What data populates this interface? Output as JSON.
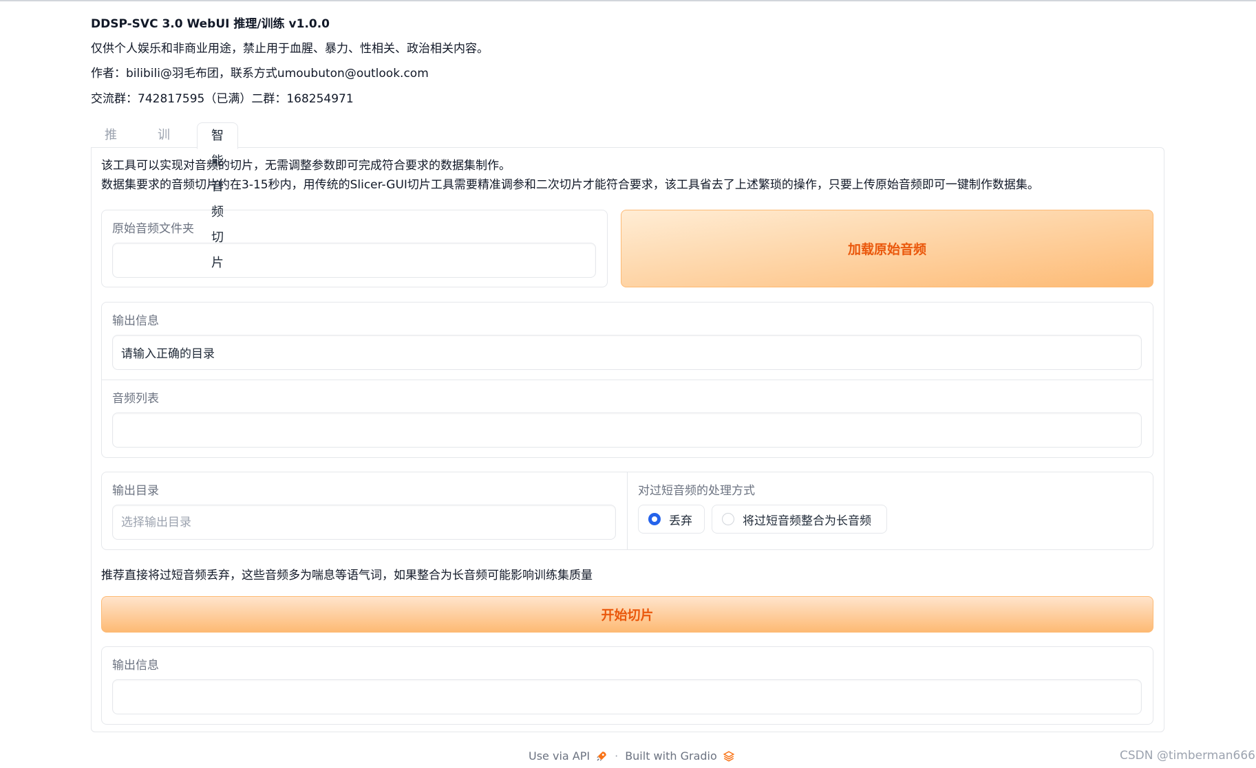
{
  "header": {
    "title": "DDSP-SVC 3.0 WebUI 推理/训练 v1.0.0",
    "notice": "仅供个人娱乐和非商业用途，禁止用于血腥、暴力、性相关、政治相关内容。",
    "author": "作者：bilibili@羽毛布团，联系方式umoubuton@outlook.com",
    "group": "交流群：742817595（已满）二群：168254971"
  },
  "tabs": {
    "infer": "推理",
    "train": "训练",
    "slice": "智能音频切片"
  },
  "slice": {
    "desc1": "该工具可以实现对音频的切片，无需调整参数即可完成符合要求的数据集制作。",
    "desc2": "数据集要求的音频切片约在3-15秒内，用传统的Slicer-GUI切片工具需要精准调参和二次切片才能符合要求，该工具省去了上述繁琐的操作，只要上传原始音频即可一键制作数据集。",
    "source_folder_label": "原始音频文件夹",
    "source_folder_value": "",
    "load_button": "加载原始音频",
    "output_info_label": "输出信息",
    "output_info_value": "请输入正确的目录",
    "audio_list_label": "音频列表",
    "audio_list_value": "",
    "output_dir_label": "输出目录",
    "output_dir_placeholder": "选择输出目录",
    "short_audio_label": "对过短音频的处理方式",
    "short_audio_options": [
      "丢弃",
      "将过短音频整合为长音频"
    ],
    "short_audio_selected": "丢弃",
    "hint": "推荐直接将过短音频丢弃，这些音频多为喘息等语气词，如果整合为长音频可能影响训练集质量",
    "start_button": "开始切片",
    "result_info_label": "输出信息",
    "result_info_value": ""
  },
  "footer": {
    "api_link": "Use via API",
    "separator": "·",
    "built_with": "Built with Gradio"
  },
  "watermark": "CSDN @timberman666",
  "colors": {
    "accent": "#ea580c",
    "button_from": "#ffedd5",
    "button_to": "#fdba74",
    "radio": "#2563eb"
  }
}
